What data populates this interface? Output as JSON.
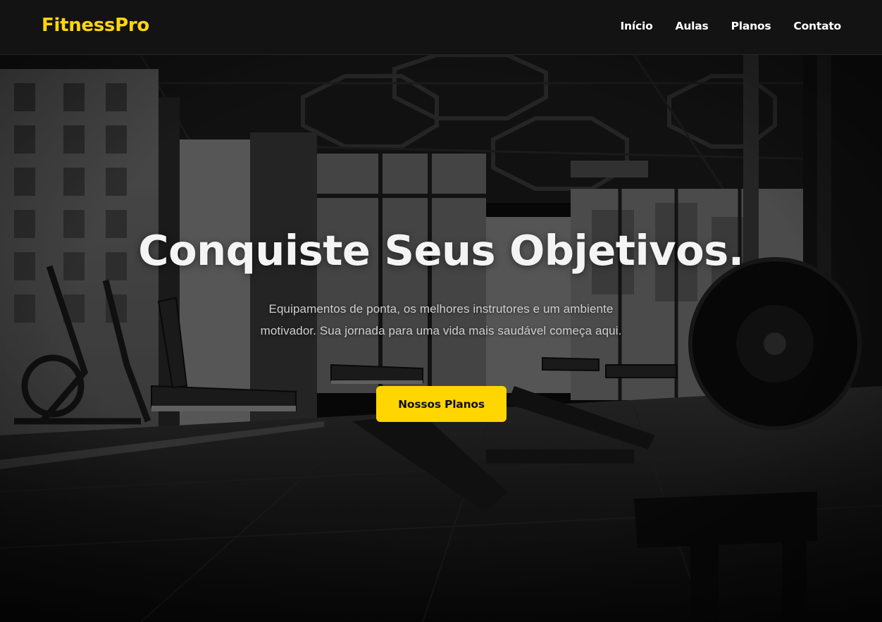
{
  "header": {
    "logo": "FitnessPro",
    "nav": [
      {
        "label": "Início"
      },
      {
        "label": "Aulas"
      },
      {
        "label": "Planos"
      },
      {
        "label": "Contato"
      }
    ]
  },
  "hero": {
    "title": "Conquiste Seus Objetivos.",
    "subtitle": "Equipamentos de ponta, os melhores instrutores e um ambiente motivador. Sua jornada para uma vida mais saudável começa aqui.",
    "cta_label": "Nossos Planos",
    "background_image": "black-and-white gym interior photo"
  },
  "colors": {
    "accent": "#ffd600",
    "header_bg": "#131313",
    "title": "#f4f4f4",
    "subtitle": "#cfcfcf"
  }
}
